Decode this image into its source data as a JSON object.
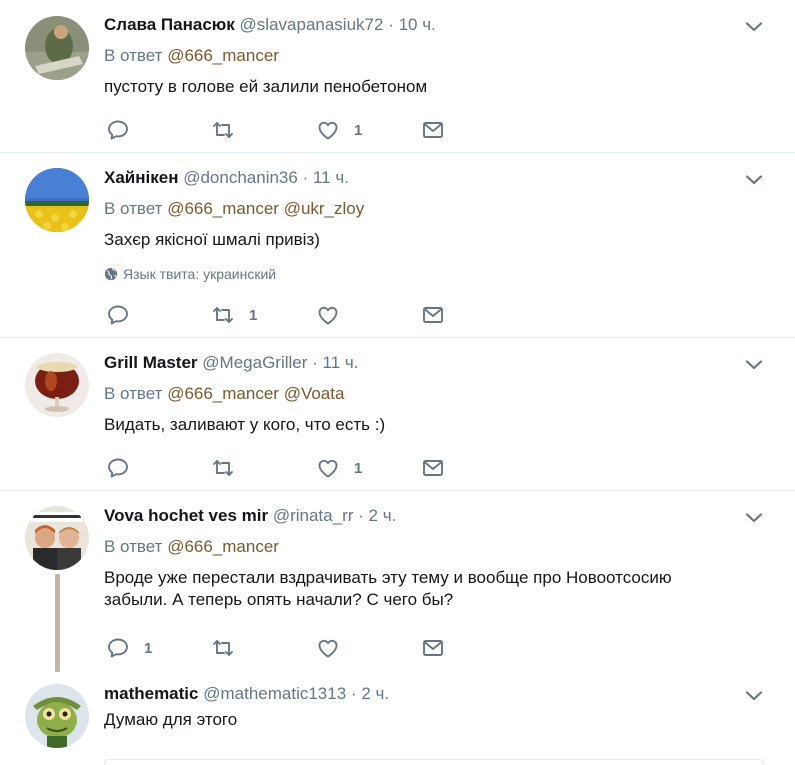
{
  "reply_prefix": "В ответ",
  "icons": {
    "reply": "reply-icon",
    "retweet": "retweet-icon",
    "like": "heart-icon",
    "dm": "envelope-icon",
    "more": "chevron-down-icon",
    "globe": "globe-icon"
  },
  "colors": {
    "text": "#14171a",
    "muted": "#657786",
    "mention": "#785a2f",
    "divider": "#e6ecf0",
    "thread_line": "#c4b6a2"
  },
  "tweets": [
    {
      "name": "Слава Панасюк",
      "handle": "@slavapanasiuk72",
      "time": "10 ч.",
      "reply_mentions": [
        "@666_mancer"
      ],
      "text": "пустоту в голове ей залили пенобетоном",
      "retweets": "",
      "likes": "1",
      "replies": ""
    },
    {
      "name": "Хайнікен",
      "handle": "@donchanin36",
      "time": "11 ч.",
      "reply_mentions": [
        "@666_mancer",
        "@ukr_zloy"
      ],
      "text": "Захєр якісної шмалі привіз)",
      "lang_note": "Язык твита: украинский",
      "retweets": "1",
      "likes": "",
      "replies": ""
    },
    {
      "name": "Grill Master",
      "handle": "@MegaGriller",
      "time": "11 ч.",
      "reply_mentions": [
        "@666_mancer",
        "@Voata"
      ],
      "text": "Видать, заливают у кого, что есть :)",
      "retweets": "",
      "likes": "1",
      "replies": ""
    },
    {
      "name": "Vova hochet ves mir",
      "handle": "@rinata_rr",
      "time": "2 ч.",
      "reply_mentions": [
        "@666_mancer"
      ],
      "text_lines": [
        "Вроде уже перестали вздрачивать эту тему и вообще про Новоотсосию",
        "забыли. А теперь опять начали? С чего бы?"
      ],
      "retweets": "",
      "likes": "",
      "replies": "1"
    },
    {
      "name": "mathematic",
      "handle": "@mathematic1313",
      "time": "2 ч.",
      "text": "Думаю для этого"
    }
  ]
}
